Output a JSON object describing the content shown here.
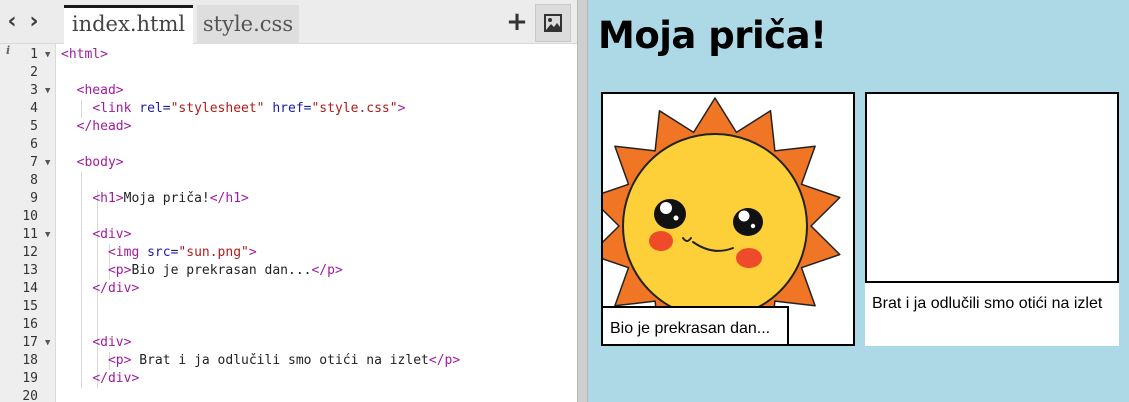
{
  "editor": {
    "tabs": [
      {
        "label": "index.html",
        "active": true
      },
      {
        "label": "style.css",
        "active": false
      }
    ],
    "nav": {
      "back_icon": "chevron-left-icon",
      "forward_icon": "chevron-right-icon"
    },
    "tools": {
      "add_icon": "plus-icon",
      "image_icon": "image-icon"
    },
    "lines": [
      {
        "n": "1",
        "fold": true,
        "code": [
          [
            "tg",
            "<html>"
          ]
        ]
      },
      {
        "n": "2",
        "fold": false,
        "code": []
      },
      {
        "n": "3",
        "fold": true,
        "code": [
          [
            "tx",
            "  "
          ],
          [
            "tg",
            "<head>"
          ]
        ]
      },
      {
        "n": "4",
        "fold": false,
        "code": [
          [
            "tx",
            "    "
          ],
          [
            "tg",
            "<link "
          ],
          [
            "at",
            "rel="
          ],
          [
            "st",
            "\"stylesheet\""
          ],
          [
            "tx",
            " "
          ],
          [
            "at",
            "href="
          ],
          [
            "st",
            "\"style.css\""
          ],
          [
            "tg",
            ">"
          ]
        ]
      },
      {
        "n": "5",
        "fold": false,
        "code": [
          [
            "tx",
            "  "
          ],
          [
            "tg",
            "</head>"
          ]
        ]
      },
      {
        "n": "6",
        "fold": false,
        "code": []
      },
      {
        "n": "7",
        "fold": true,
        "code": [
          [
            "tx",
            "  "
          ],
          [
            "tg",
            "<body>"
          ]
        ]
      },
      {
        "n": "8",
        "fold": false,
        "code": []
      },
      {
        "n": "9",
        "fold": false,
        "code": [
          [
            "tx",
            "    "
          ],
          [
            "tg",
            "<h1>"
          ],
          [
            "tx",
            "Moja priča!"
          ],
          [
            "tg",
            "</h1>"
          ]
        ]
      },
      {
        "n": "10",
        "fold": false,
        "code": []
      },
      {
        "n": "11",
        "fold": true,
        "code": [
          [
            "tx",
            "    "
          ],
          [
            "tg",
            "<div>"
          ]
        ]
      },
      {
        "n": "12",
        "fold": false,
        "code": [
          [
            "tx",
            "      "
          ],
          [
            "tg",
            "<img "
          ],
          [
            "at",
            "src="
          ],
          [
            "st",
            "\"sun.png\""
          ],
          [
            "tg",
            ">"
          ]
        ]
      },
      {
        "n": "13",
        "fold": false,
        "code": [
          [
            "tx",
            "      "
          ],
          [
            "tg",
            "<p>"
          ],
          [
            "tx",
            "Bio je prekrasan dan..."
          ],
          [
            "tg",
            "</p>"
          ]
        ]
      },
      {
        "n": "14",
        "fold": false,
        "code": [
          [
            "tx",
            "    "
          ],
          [
            "tg",
            "</div>"
          ]
        ]
      },
      {
        "n": "15",
        "fold": false,
        "code": []
      },
      {
        "n": "16",
        "fold": false,
        "code": []
      },
      {
        "n": "17",
        "fold": true,
        "code": [
          [
            "tx",
            "    "
          ],
          [
            "tg",
            "<div>"
          ]
        ]
      },
      {
        "n": "18",
        "fold": false,
        "code": [
          [
            "tx",
            "      "
          ],
          [
            "tg",
            "<p>"
          ],
          [
            "tx",
            " Brat i ja odlučili smo otići na izlet"
          ],
          [
            "tg",
            "</p>"
          ]
        ]
      },
      {
        "n": "19",
        "fold": false,
        "code": [
          [
            "tx",
            "    "
          ],
          [
            "tg",
            "</div>"
          ]
        ]
      },
      {
        "n": "20",
        "fold": false,
        "code": []
      }
    ]
  },
  "preview": {
    "title": "Moja priča!",
    "panels": [
      {
        "image": "sun-icon",
        "caption": "Bio je prekrasan dan..."
      },
      {
        "caption": "Brat i ja odlučili smo otići na izlet"
      }
    ]
  },
  "colors": {
    "preview_background": "#add8e6",
    "tag": "#a11aa1",
    "attribute": "#1a1aa6",
    "string": "#b11b1b",
    "sun_rays": "#f07524",
    "sun_face": "#fdd03a",
    "cheeks": "#ee4b2b"
  }
}
